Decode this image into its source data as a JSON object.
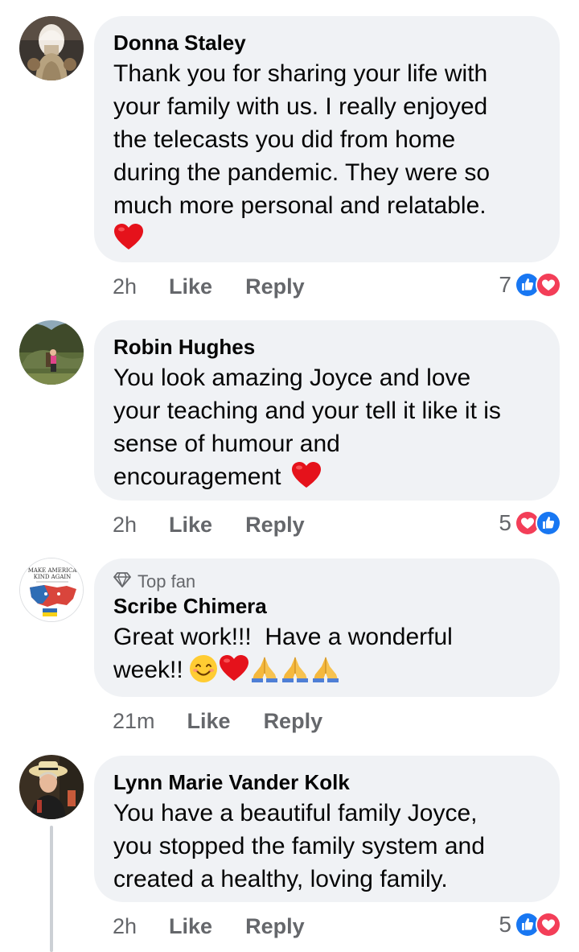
{
  "comments": [
    {
      "author": "Donna Staley",
      "badge": "",
      "lines": [
        "Thank you for sharing your life with",
        "your family with us. I really enjoyed",
        "the telecasts you did from home",
        "during the pandemic. They were so",
        "much more personal and relatable."
      ],
      "emoji_line": [
        "red-heart-emoji"
      ],
      "time": "2h",
      "like_label": "Like",
      "reply_label": "Reply",
      "reaction_count": "7",
      "reactions": [
        "like-reaction-icon",
        "love-reaction-icon"
      ]
    },
    {
      "author": "Robin Hughes",
      "badge": "",
      "lines": [
        "You look amazing Joyce and love",
        "your teaching and your tell it like it is",
        "sense of humour and",
        "encouragement"
      ],
      "trailing_emoji": "red-heart-emoji",
      "time": "2h",
      "like_label": "Like",
      "reply_label": "Reply",
      "reaction_count": "5",
      "reactions": [
        "love-reaction-icon",
        "like-reaction-icon"
      ]
    },
    {
      "author": "Scribe Chimera",
      "badge": "Top fan",
      "badge_icon": "diamond-icon",
      "lines": [
        "Great work!!!  Have a wonderful",
        "week!!"
      ],
      "trailing_emojis": [
        "smiling-face-emoji",
        "red-heart-emoji",
        "folded-hands-emoji",
        "folded-hands-emoji",
        "folded-hands-emoji"
      ],
      "avatar_text": [
        "MAKE AMERICA",
        "KIND AGAIN"
      ],
      "time": "21m",
      "like_label": "Like",
      "reply_label": "Reply",
      "reaction_count": "",
      "reactions": []
    },
    {
      "author": "Lynn Marie Vander Kolk",
      "badge": "",
      "lines": [
        "You have a beautiful family Joyce,",
        "you stopped the family system and",
        "created a healthy, loving family."
      ],
      "time": "2h",
      "like_label": "Like",
      "reply_label": "Reply",
      "reaction_count": "5",
      "reactions": [
        "like-reaction-icon",
        "love-reaction-icon"
      ]
    }
  ],
  "colors": {
    "bubble": "#f0f2f5",
    "meta_text": "#65676b",
    "like_blue": "#1877f2",
    "love_red": "#f33e58",
    "thread_line": "#ccd0d5"
  }
}
